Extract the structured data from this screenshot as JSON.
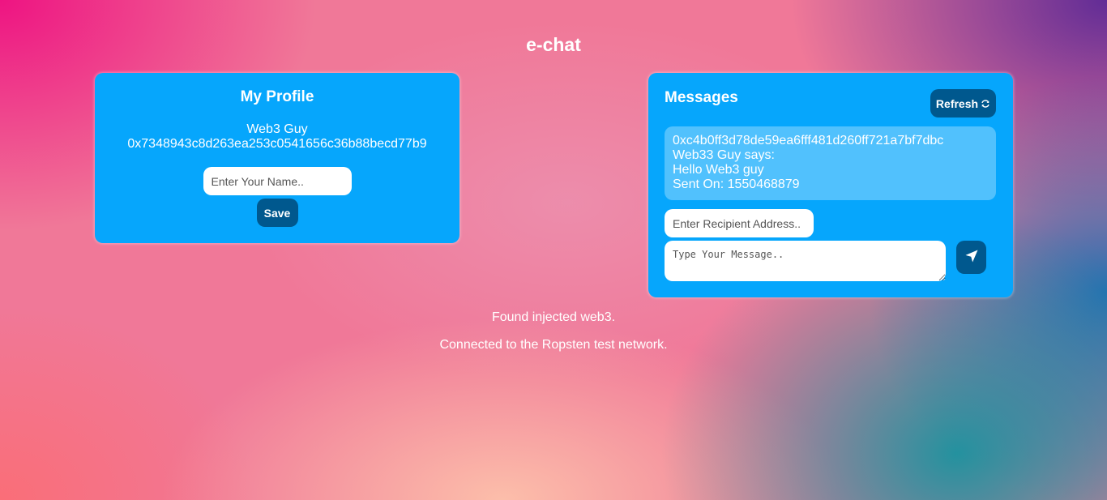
{
  "app": {
    "title": "e-chat"
  },
  "profile": {
    "title": "My Profile",
    "name": "Web3 Guy",
    "address": "0x7348943c8d263ea253c0541656c36b88becd77b9",
    "name_input_placeholder": "Enter Your Name..",
    "save_label": "Save"
  },
  "messages": {
    "title": "Messages",
    "refresh_label": "Refresh",
    "refresh_icon": "refresh-icon",
    "items": [
      {
        "from": "0xc4b0ff3d78de59ea6fff481d260ff721a7bf7dbc",
        "says": "Web33 Guy says:",
        "text": "Hello Web3 guy",
        "sent_on": "Sent On: 1550468879"
      }
    ],
    "recipient_placeholder": "Enter Recipient Address..",
    "message_placeholder": "Type Your Message..",
    "send_icon": "send-icon"
  },
  "status": {
    "line1": "Found injected web3.",
    "line2": "Connected to the Ropsten test network."
  },
  "colors": {
    "card_bg": "#06a6fc",
    "button_bg": "#00588e",
    "text": "#ffffff"
  }
}
